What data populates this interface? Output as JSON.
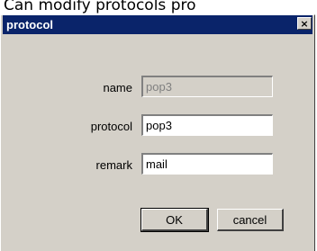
{
  "caption": "Can modify protocols pro",
  "window": {
    "title": "protocol",
    "close_symbol": "×"
  },
  "form": {
    "name_label": "name",
    "name_value": "pop3",
    "protocol_label": "protocol",
    "protocol_value": "pop3",
    "remark_label": "remark",
    "remark_value": "mail"
  },
  "buttons": {
    "ok_label": "OK",
    "cancel_label": "cancel"
  },
  "colors": {
    "titlebar": "#0a246a",
    "dialog_bg": "#d4d0c8"
  }
}
